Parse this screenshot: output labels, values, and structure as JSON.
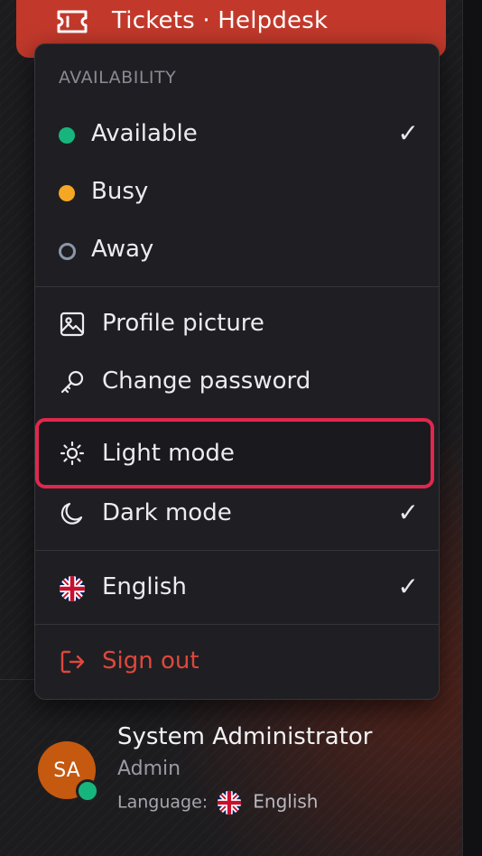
{
  "nav": {
    "label": "Tickets · Helpdesk",
    "icon": "ticket-icon",
    "color": "#c2392b"
  },
  "menu": {
    "section_title": "AVAILABILITY",
    "availability": [
      {
        "label": "Available",
        "status_color": "#17b57e",
        "checked": true,
        "check": "✓"
      },
      {
        "label": "Busy",
        "status_color": "#f5a623",
        "checked": false
      },
      {
        "label": "Away",
        "status_color": "#8b97a8",
        "checked": false
      }
    ],
    "account": [
      {
        "label": "Profile picture",
        "icon": "image-icon"
      },
      {
        "label": "Change password",
        "icon": "key-icon"
      }
    ],
    "theme": [
      {
        "label": "Light mode",
        "icon": "sun-icon",
        "checked": false,
        "highlighted": true
      },
      {
        "label": "Dark mode",
        "icon": "moon-icon",
        "checked": true,
        "check": "✓"
      }
    ],
    "language": {
      "label": "English",
      "icon": "uk-flag-icon",
      "checked": true,
      "check": "✓"
    },
    "sign_out": {
      "label": "Sign out",
      "icon": "logout-icon",
      "color": "#e0473b"
    },
    "highlight_color": "#e0274f"
  },
  "user": {
    "initials": "SA",
    "name": "System Administrator",
    "role": "Admin",
    "language_label": "Language:",
    "language_value": "English",
    "status_color": "#17b57e",
    "avatar_color": "#c5590f"
  }
}
